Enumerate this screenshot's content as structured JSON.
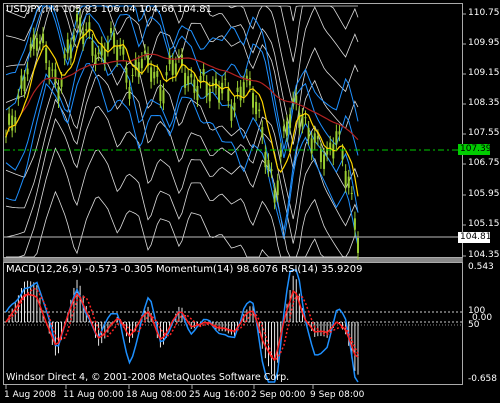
{
  "window": {
    "symbol_header": "USDJPY,H4  105.83 106.04 104.66 104.81",
    "indicator_header": "MACD(12,26,9) -0.573 -0.305  Momentum(14) 98.6076  RSI(14) 35.9209",
    "copyright": "Windsor Direct 4, © 2001-2008 MetaQuotes Software Corp."
  },
  "colors": {
    "background": "#000000",
    "candle": "#9acd32",
    "bollinger": "#dcdcdc",
    "envelope": "#1e90ff",
    "ma_slow": "#b22222",
    "ma_fast": "#ffd700",
    "level_line": "#00cc00",
    "macd_main": "#ff2222",
    "momentum": "#1e90ff",
    "histogram": "#ffffff"
  },
  "price_axis": {
    "labels": [
      "110.75",
      "109.95",
      "109.15",
      "108.35",
      "107.55",
      "106.75",
      "105.95",
      "105.15",
      "104.35"
    ],
    "level_tag": "107.39",
    "current_tag": "104.81"
  },
  "indicator_axis": {
    "labels": [
      "0.543",
      "100",
      "50",
      "0.00",
      "-0.658"
    ]
  },
  "time_axis": {
    "labels": [
      "1 Aug 2008",
      "11 Aug 00:00",
      "18 Aug 08:00",
      "25 Aug 16:00",
      "2 Sep 00:00",
      "9 Sep 08:00"
    ]
  },
  "chart_data": {
    "type": "line",
    "price_range": [
      104.35,
      110.75
    ],
    "price_path": [
      107.5,
      108.2,
      109.3,
      110.2,
      109.6,
      108.7,
      109.8,
      110.5,
      110.2,
      109.5,
      110.1,
      109.9,
      108.8,
      109.6,
      109.4,
      108.6,
      109.5,
      109.4,
      108.8,
      109.0,
      108.7,
      108.9,
      108.2,
      109.0,
      108.6,
      107.2,
      105.9,
      107.8,
      108.4,
      107.7,
      107.3,
      106.9,
      107.6,
      106.4,
      104.81
    ],
    "level_line": 107.39,
    "current_price": 104.81,
    "indicator_range": [
      -0.658,
      0.543
    ]
  }
}
